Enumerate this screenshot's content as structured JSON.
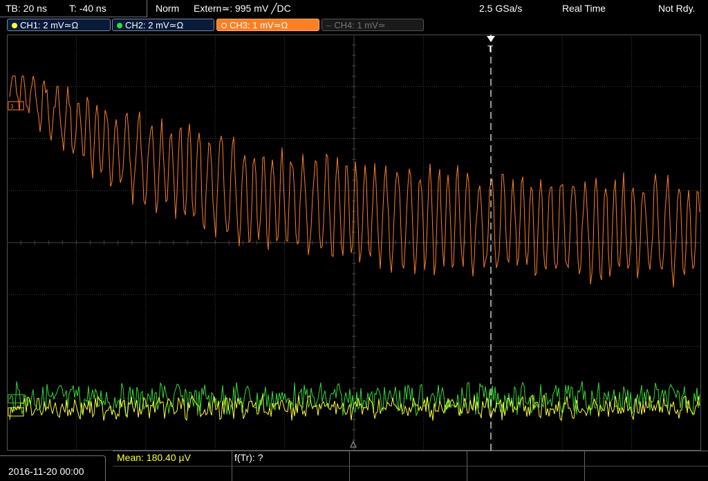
{
  "timebase": {
    "tb": "TB: 20 ns",
    "trig_pos": "T: -40 ns"
  },
  "status": {
    "mode": "Norm",
    "trigger": "Extern≃: 995 mV ╱DC",
    "sample_rate": "2.5 GSa/s",
    "acq": "Real Time",
    "state": "Not Rdy."
  },
  "channels": [
    {
      "label": "CH1: 2 mV≃Ω",
      "color": "#ffff33",
      "state": "on"
    },
    {
      "label": "CH2: 2 mV≃Ω",
      "color": "#33dd33",
      "state": "on"
    },
    {
      "label": "CH3: 1 mV≃Ω",
      "color": "#ff7f24",
      "state": "active"
    },
    {
      "label": "CH4: 1 mV≃",
      "color": "#777777",
      "state": "off"
    }
  ],
  "colors": {
    "ch1": "#ffff33",
    "ch2": "#33dd33",
    "ch3": "#ff7f24",
    "grid": "#444444",
    "marker": "#ffffff"
  },
  "markers": {
    "trigger_label": "T"
  },
  "date": "2016-11-20 00:00",
  "measurements": {
    "mean": "Mean: 180.40 µV",
    "freq": "f(Tr): ?"
  }
}
